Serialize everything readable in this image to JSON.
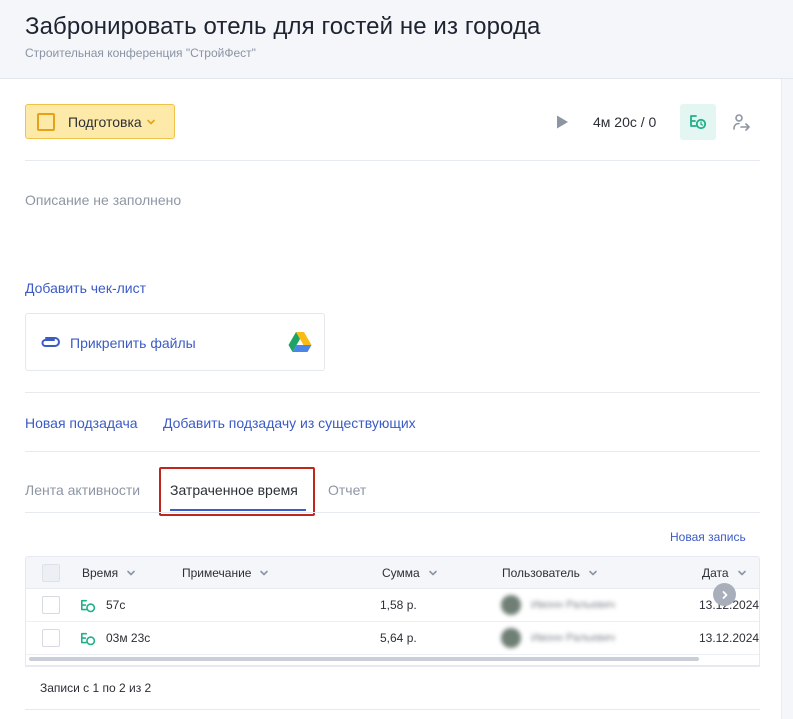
{
  "header": {
    "title": "Забронировать отель для гостей не из города",
    "subtitle": "Строительная конференция \"СтройФест\""
  },
  "toolbar": {
    "status_label": "Подготовка",
    "status_color": "#fde9a8",
    "timer": "4м 20с / 0",
    "icons": [
      "play-icon",
      "time-track-icon",
      "assign-icon"
    ]
  },
  "task": {
    "description_placeholder": "Описание не заполнено",
    "add_checklist": "Добавить чек-лист",
    "attach_files": "Прикрепить файлы",
    "new_subtask": "Новая подзадача",
    "add_existing_subtask": "Добавить подзадачу из существующих"
  },
  "tabs": [
    {
      "label": "Лента активности",
      "active": false
    },
    {
      "label": "Затраченное время",
      "active": true
    },
    {
      "label": "Отчет",
      "active": false
    }
  ],
  "time_table": {
    "new_record": "Новая запись",
    "columns": [
      "Время",
      "Примечание",
      "Сумма",
      "Пользователь",
      "Дата"
    ],
    "rows": [
      {
        "time": "57с",
        "note": "",
        "sum": "1,58 р.",
        "user": "Ивонн Ральевич",
        "date": "13.12.2024"
      },
      {
        "time": "03м 23с",
        "note": "",
        "sum": "5,64 р.",
        "user": "Ивонн Ральевич",
        "date": "13.12.2024"
      }
    ],
    "pagination": "Записи с 1 по 2 из 2"
  },
  "colors": {
    "accent": "#3b5bc5",
    "timer_green": "#1fb08a",
    "highlight_red": "#c0271c"
  }
}
